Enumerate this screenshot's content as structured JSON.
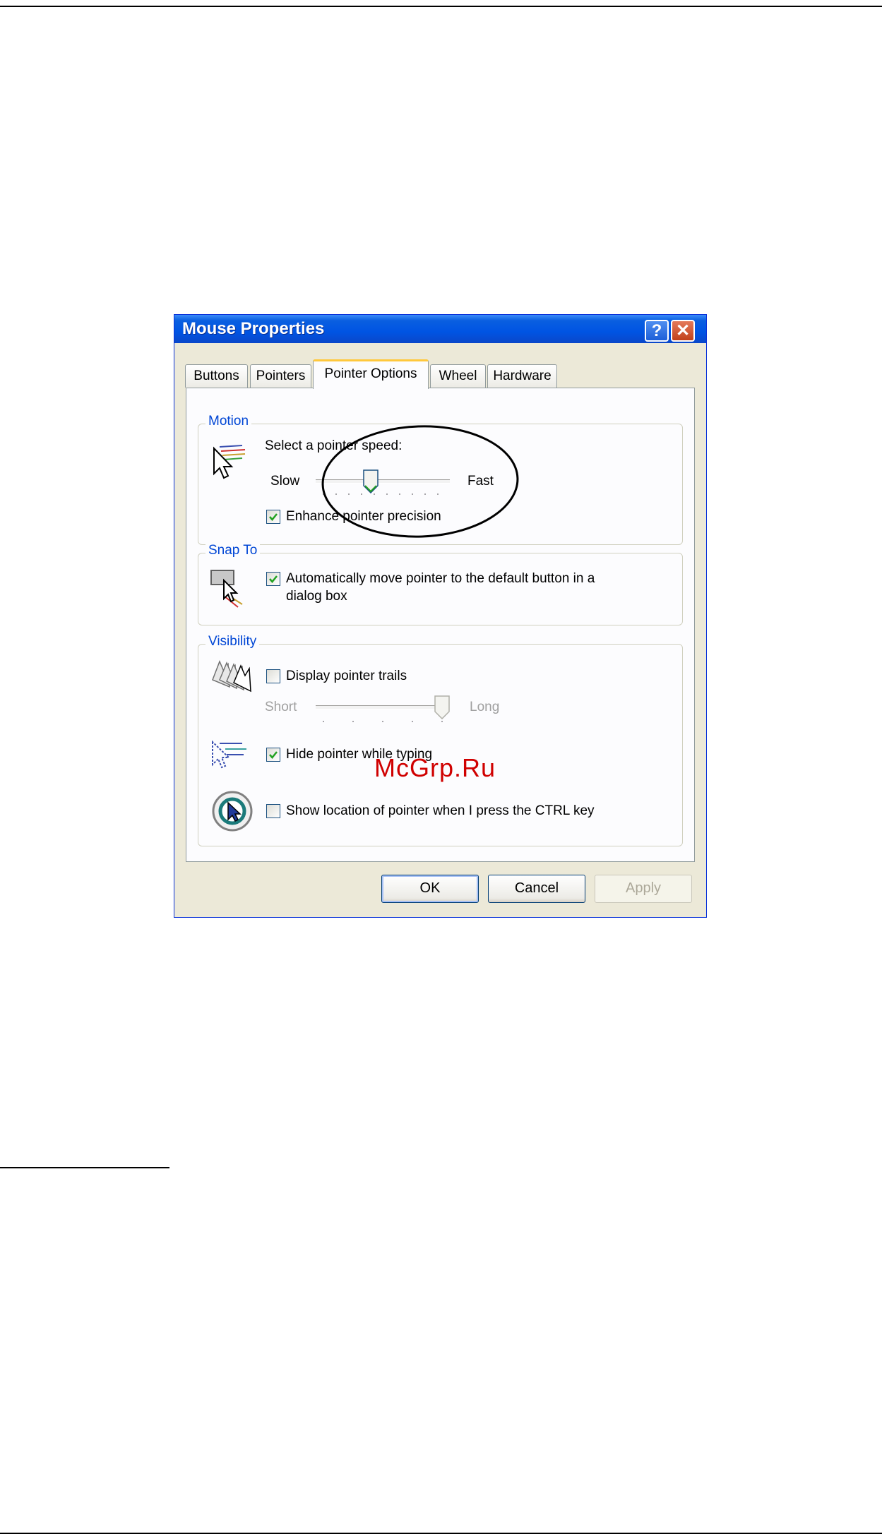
{
  "dialog": {
    "title": "Mouse Properties",
    "help_glyph": "?",
    "close_glyph": "✕",
    "tabs": [
      {
        "label": "Buttons"
      },
      {
        "label": "Pointers"
      },
      {
        "label": "Pointer Options"
      },
      {
        "label": "Wheel"
      },
      {
        "label": "Hardware"
      }
    ],
    "active_tab": "Pointer Options"
  },
  "motion": {
    "group_label": "Motion",
    "prompt": "Select a pointer speed:",
    "slow_label": "Slow",
    "fast_label": "Fast",
    "speed_level": 0.4,
    "enhance_label": "Enhance pointer precision",
    "enhance_checked": true
  },
  "snap": {
    "group_label": "Snap To",
    "line1": "Automatically move pointer to the default button in a",
    "line2": "dialog box",
    "checked": true
  },
  "visibility": {
    "group_label": "Visibility",
    "trails_label": "Display pointer trails",
    "trails_checked": false,
    "short_label": "Short",
    "long_label": "Long",
    "trail_level": 1.0,
    "hide_label": "Hide pointer while typing",
    "hide_checked": true,
    "ctrl_label": "Show location of pointer when I press the CTRL key",
    "ctrl_checked": false
  },
  "buttons": {
    "ok": "OK",
    "cancel": "Cancel",
    "apply": "Apply"
  },
  "watermark": "McGrp.Ru",
  "colors": {
    "titlebar": "#0054e3",
    "group_label": "#0046d5",
    "check_mark": "#21a121",
    "watermark": "#d00000"
  }
}
